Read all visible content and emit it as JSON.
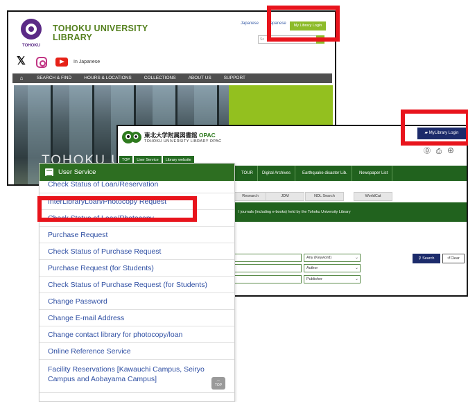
{
  "library_site": {
    "title_line1": "TOHOKU UNIVERSITY",
    "title_line2": "LIBRARY",
    "logo_caption": "TOHOKU",
    "links": [
      "Japanese",
      "Japanese"
    ],
    "mylibrary_button": "My Library Login",
    "in_japanese": "In Japanese",
    "nav": [
      "SEARCH & FIND",
      "HOURS & LOCATIONS",
      "COLLECTIONS",
      "ABOUT US",
      "SUPPORT"
    ],
    "banner_text": "TOHOKU U"
  },
  "opac": {
    "title_jp": "東北大学附属図書館",
    "title_opac": "OPAC",
    "subtitle": "TOHOKU UNIVERSITY LIBRARY OPAC",
    "mylibrary_button": "MyLibrary Login",
    "top_nav": [
      "TOP",
      "User Service",
      "Library website"
    ],
    "main_nav": [
      "TOUR",
      "Digital Archives",
      "Earthquake disaster Lib.",
      "Newspaper List"
    ],
    "db_tabs": [
      "Research",
      "JDM",
      "NDL Search",
      "WorldCat"
    ],
    "info_text": "l journals (including e-books) held by the Tohoku University Library",
    "field_options": [
      "Any (Keyword)",
      "Author",
      "Publisher"
    ],
    "search_button": "Search",
    "clear_button": "Clear"
  },
  "user_service": {
    "header": "User Service",
    "items": [
      "Check Status of Loan/Reservation",
      "InterLibraryLoan/Photocopy Request",
      "Check Status of Loan/Photocopy",
      "Purchase Request",
      "Check Status of Purchase Request",
      "Purchase Request (for Students)",
      "Check Status of Purchase Request (for Students)",
      "Change Password",
      "Change E-mail Address",
      "Change contact library for photocopy/loan",
      "Online Reference Service",
      "Facility Reservations [Kawauchi Campus, Seiryo Campus and Aobayama Campus]"
    ],
    "to_top": "TOP"
  },
  "colors": {
    "highlight": "#e8141c",
    "opac_green": "#21621e",
    "navy": "#1c2b6b",
    "link_blue": "#2f4fa3",
    "lib_green": "#93c01f"
  }
}
